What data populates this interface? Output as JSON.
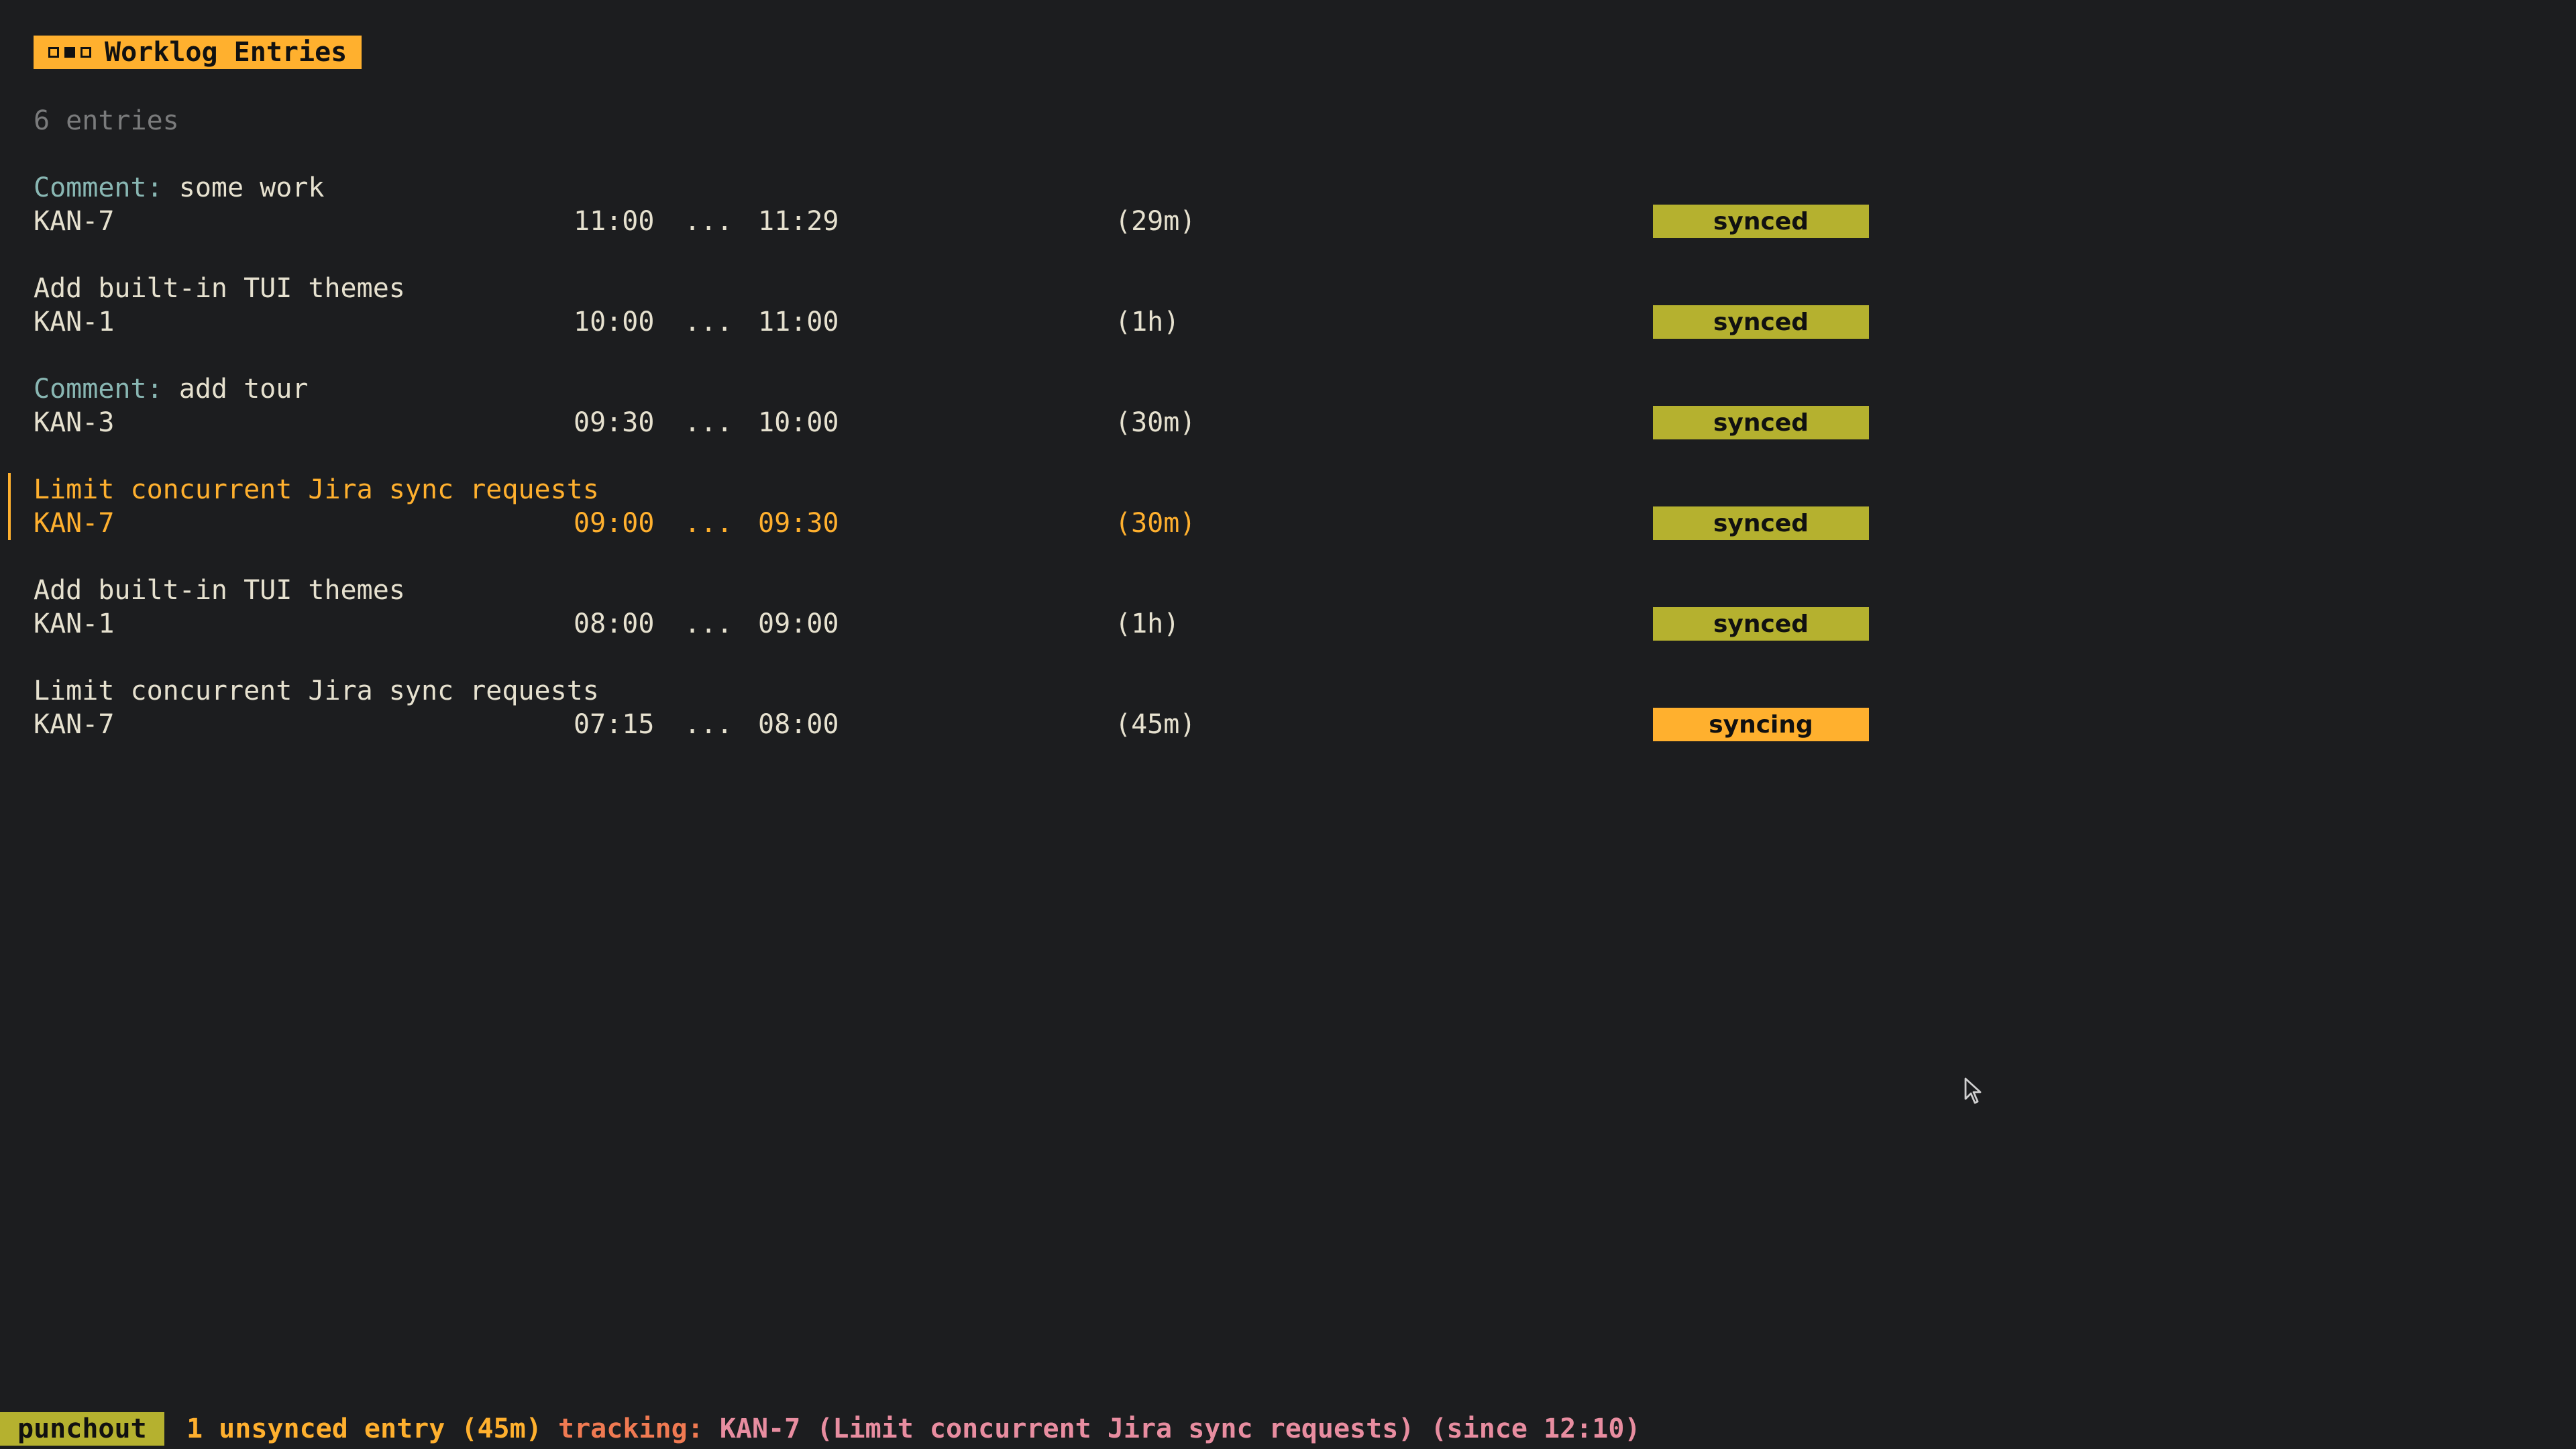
{
  "title": "Worklog Entries",
  "count_label": "6 entries",
  "comment_prefix": "Comment:",
  "entries": [
    {
      "comment": true,
      "text": "some work",
      "key": "KAN-7",
      "start": "11:00",
      "sep": "...",
      "end": "11:29",
      "duration": "(29m)",
      "status": "synced"
    },
    {
      "comment": false,
      "text": "Add built-in TUI themes",
      "key": "KAN-1",
      "start": "10:00",
      "sep": "...",
      "end": "11:00",
      "duration": "(1h)",
      "status": "synced"
    },
    {
      "comment": true,
      "text": "add tour",
      "key": "KAN-3",
      "start": "09:30",
      "sep": "...",
      "end": "10:00",
      "duration": "(30m)",
      "status": "synced"
    },
    {
      "comment": false,
      "text": "Limit concurrent Jira sync requests",
      "key": "KAN-7",
      "start": "09:00",
      "sep": "...",
      "end": "09:30",
      "duration": "(30m)",
      "status": "synced"
    },
    {
      "comment": false,
      "text": "Add built-in TUI themes",
      "key": "KAN-1",
      "start": "08:00",
      "sep": "...",
      "end": "09:00",
      "duration": "(1h)",
      "status": "synced"
    },
    {
      "comment": false,
      "text": "Limit concurrent Jira sync requests",
      "key": "KAN-7",
      "start": "07:15",
      "sep": "...",
      "end": "08:00",
      "duration": "(45m)",
      "status": "syncing"
    }
  ],
  "selected_index": 3,
  "status_bar": {
    "app_name": "punchout",
    "unsynced": "1 unsynced entry (45m)",
    "tracking_label": "tracking:",
    "tracking_detail": "KAN-7 (Limit concurrent Jira sync requests) (since 12:10)"
  },
  "colors": {
    "background": "#1c1d1f",
    "accent": "#ffb02e",
    "synced": "#b5b12f",
    "syncing": "#ffb02e",
    "comment_prefix": "#89b7b3"
  }
}
